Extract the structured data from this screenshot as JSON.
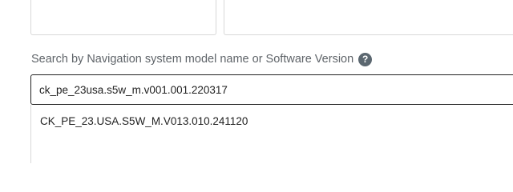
{
  "search": {
    "label": "Search by Navigation system model name or Software Version",
    "help_icon_glyph": "?",
    "input_value": "ck_pe_23usa.s5w_m.v001.001.220317"
  },
  "results": {
    "items": [
      {
        "label": "CK_PE_23.USA.S5W_M.V013.010.241120"
      }
    ]
  },
  "colors": {
    "label_text": "#5f6469",
    "help_icon_bg": "#5b6770",
    "input_border": "#222222",
    "box_border": "#d8d8d8"
  },
  "icons": {
    "help": "question-circle-icon"
  }
}
